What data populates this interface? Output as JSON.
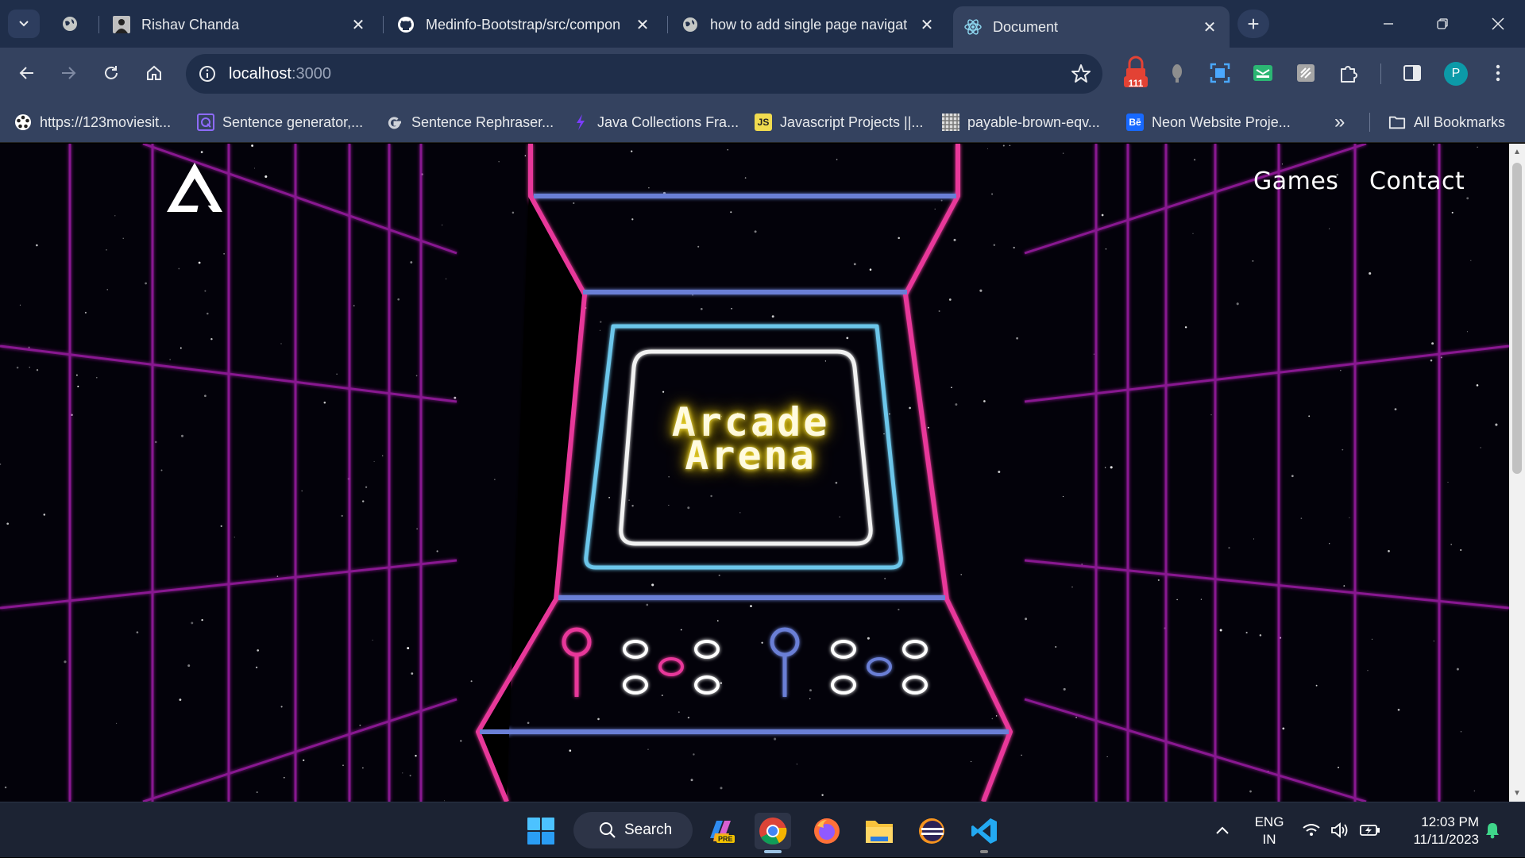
{
  "browser": {
    "tabs": [
      {
        "title": "Rishav Chanda",
        "icon": "profile-photo-icon"
      },
      {
        "title": "Medinfo-Bootstrap/src/compon",
        "icon": "github-icon"
      },
      {
        "title": "how to add single page navigat",
        "icon": "globe-icon"
      },
      {
        "title": "Document",
        "icon": "react-icon",
        "active": true
      }
    ],
    "url_host": "localhost",
    "url_port": ":3000",
    "profile_initial": "P",
    "extension_badge": "111",
    "bookmarks": [
      {
        "label": "https://123moviesit...",
        "icon": "film-reel-icon"
      },
      {
        "label": "Sentence generator,...",
        "icon": "quillbot-icon"
      },
      {
        "label": "Sentence Rephraser...",
        "icon": "google-g-icon"
      },
      {
        "label": "Java Collections Fra...",
        "icon": "bolt-icon"
      },
      {
        "label": "Javascript Projects ||...",
        "icon": "js-icon"
      },
      {
        "label": "payable-brown-eqv...",
        "icon": "pattern-icon"
      },
      {
        "label": "Neon Website Proje...",
        "icon": "behance-icon"
      }
    ],
    "bookmark_js_badge": "JS",
    "bookmark_be_badge": "Bē",
    "overflow": "»",
    "all_bookmarks": "All Bookmarks"
  },
  "site": {
    "nav": {
      "games": "Games",
      "contact": "Contact"
    },
    "title_line1": "Arcade",
    "title_line2": "Arena",
    "colors": {
      "neon_pink": "#e8389a",
      "neon_blue": "#6a7fd6",
      "screen_cyan": "#6cc6ea",
      "grid_purple": "#b01cb0",
      "title_glow": "#ffe94a"
    }
  },
  "taskbar": {
    "search_label": "Search",
    "pre_badge": "PRE",
    "lang_line1": "ENG",
    "lang_line2": "IN",
    "time": "12:03 PM",
    "date": "11/11/2023"
  }
}
